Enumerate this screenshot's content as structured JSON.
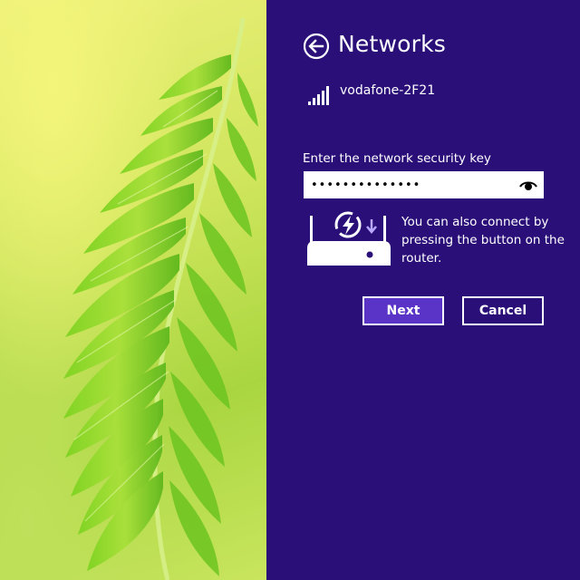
{
  "header": {
    "title": "Networks",
    "back_icon": "back-arrow-icon"
  },
  "network": {
    "name": "vodafone-2F21",
    "signal_icon": "wifi-signal-icon",
    "signal_bars": 5
  },
  "security": {
    "label": "Enter the network security key",
    "value": "••••••••••••••",
    "reveal_icon": "eye-icon"
  },
  "wps": {
    "icon": "router-wps-icon",
    "text": "You can also connect by pressing the button on the router."
  },
  "buttons": {
    "next_label": "Next",
    "cancel_label": "Cancel"
  },
  "colors": {
    "panel_bg": "#2a0f79",
    "primary_button": "#5a34c6",
    "text": "#ffffff"
  }
}
